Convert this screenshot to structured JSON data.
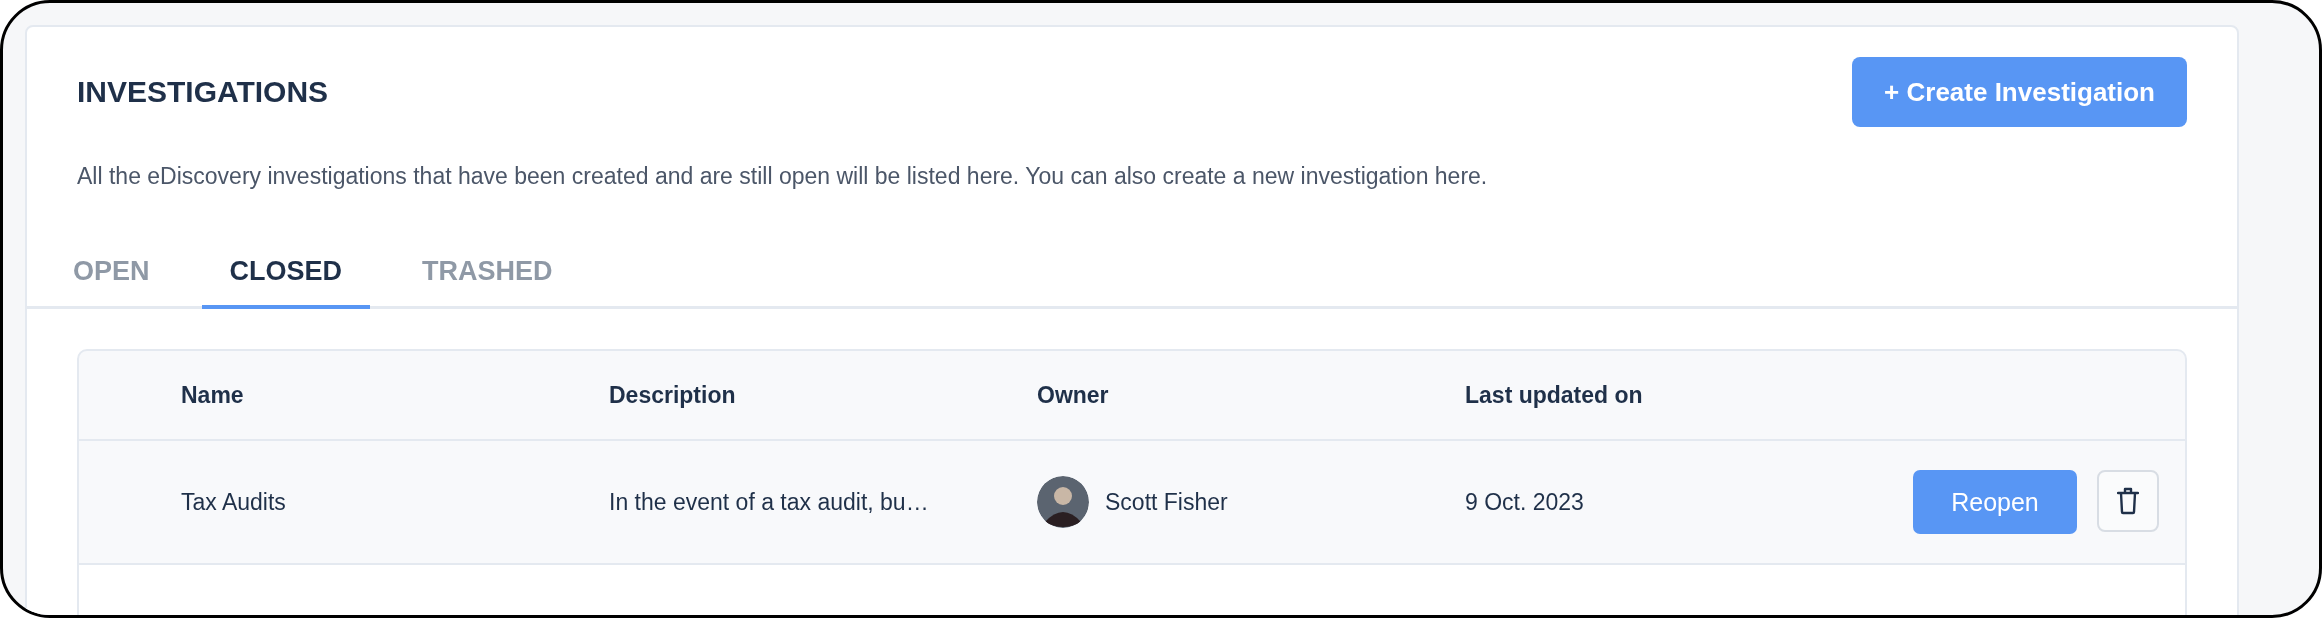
{
  "header": {
    "title": "INVESTIGATIONS",
    "description": "All the eDiscovery investigations that have been created and are still open will be listed here. You can also create a new investigation here.",
    "create_button": "+ Create Investigation"
  },
  "tabs": [
    {
      "label": "OPEN",
      "selected": false
    },
    {
      "label": "CLOSED",
      "selected": true
    },
    {
      "label": "TRASHED",
      "selected": false
    }
  ],
  "table": {
    "columns": [
      "Name",
      "Description",
      "Owner",
      "Last updated on"
    ],
    "rows": [
      {
        "name": "Tax Audits",
        "description": "In the event of a tax audit, bu…",
        "owner": "Scott Fisher",
        "last_updated": "9 Oct. 2023",
        "action": "Reopen"
      }
    ]
  }
}
